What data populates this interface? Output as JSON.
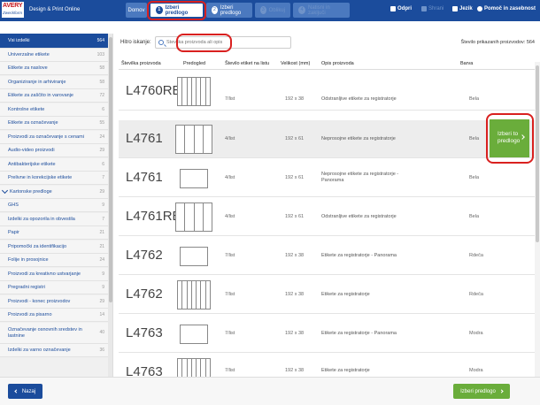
{
  "header": {
    "logo_top": "AVERY",
    "logo_bottom": "Zweckform",
    "app_title": "Design & Print Online",
    "steps": [
      {
        "num": "",
        "label": "Domov"
      },
      {
        "num": "1",
        "label": "Izberi predlogo"
      },
      {
        "num": "2",
        "label": "Izberi predlogo"
      },
      {
        "num": "3",
        "label": "Oblikuj"
      },
      {
        "num": "4",
        "label": "Natisni in zaključi"
      }
    ],
    "actions": {
      "open": "Odpri",
      "save": "Shrani",
      "language": "Jezik",
      "help": "Pomoč in zasebnost"
    }
  },
  "sidebar": {
    "items": [
      {
        "label": "Vsi izdelki",
        "count": "564"
      },
      {
        "label": "Univerzalne etikete",
        "count": "103"
      },
      {
        "label": "Etikete za naslove",
        "count": "58"
      },
      {
        "label": "Organiziranje in arhiviranje",
        "count": "58"
      },
      {
        "label": "Etikete za zaščito in varovanje",
        "count": "72"
      },
      {
        "label": "Kontrolne etikete",
        "count": "6"
      },
      {
        "label": "Etikete za označevanje",
        "count": "55"
      },
      {
        "label": "Proizvodi za označevanje s cenami",
        "count": "24"
      },
      {
        "label": "Audio-video proizvodi",
        "count": "29"
      },
      {
        "label": "Antibakterijske etikete",
        "count": "6"
      },
      {
        "label": "Prelivne in korekcijske etikete",
        "count": "7"
      },
      {
        "label": "Kartonske predloge",
        "count": "29"
      },
      {
        "label": "GHS",
        "count": "9"
      },
      {
        "label": "Izdelki za opozorila in obvestila",
        "count": "7"
      },
      {
        "label": "Papir",
        "count": "21"
      },
      {
        "label": "Pripomočki za identifikacijo",
        "count": "21"
      },
      {
        "label": "Folije in prosojnice",
        "count": "24"
      },
      {
        "label": "Proizvodi za kreativno ustvarjanje",
        "count": "9"
      },
      {
        "label": "Pregradni registri",
        "count": "9"
      },
      {
        "label": "Proizvodi - konec proizvodov",
        "count": "29"
      },
      {
        "label": "Proizvodi za pisarno",
        "count": "14"
      },
      {
        "label": "Označevanje osnovnih sredstev in lastnine",
        "count": "40"
      },
      {
        "label": "Izdelki za varno označevanje",
        "count": "36"
      }
    ]
  },
  "search": {
    "label": "Hitro iskanje:",
    "placeholder": "Številka proizvoda ali opis"
  },
  "shown_count": "Število prikazanih proizvodov: 564",
  "table": {
    "headers": {
      "code": "Številka proizvoda",
      "preview": "Predogled",
      "per_sheet": "Število etiket na listu",
      "size": "Velikost (mm)",
      "desc": "Opis proizvoda",
      "color": "Barva"
    },
    "rows": [
      {
        "code": "L4760REV",
        "per_sheet": "7/list",
        "size": "192 x 38",
        "desc": "Odstranljive etikete za registratorje",
        "color": "Bela"
      },
      {
        "code": "L4761",
        "per_sheet": "4/list",
        "size": "192 x 61",
        "desc": "Neprosojne etikete za registratorje",
        "color": "Bela"
      },
      {
        "code": "L4761",
        "per_sheet": "4/list",
        "size": "192 x 61",
        "desc": "Neprosojne etikete za registratorje - Panorama",
        "color": "Bela"
      },
      {
        "code": "L4761REV",
        "per_sheet": "4/list",
        "size": "192 x 61",
        "desc": "Odstranljive etikete za registratorje",
        "color": "Bela"
      },
      {
        "code": "L4762",
        "per_sheet": "7/list",
        "size": "192 x 38",
        "desc": "Etikete za registratorje - Panorama",
        "color": "Rdeča"
      },
      {
        "code": "L4762",
        "per_sheet": "7/list",
        "size": "192 x 38",
        "desc": "Etikete za registratorje",
        "color": "Rdeča"
      },
      {
        "code": "L4763",
        "per_sheet": "7/list",
        "size": "192 x 38",
        "desc": "Etikete za registratorje - Panorama",
        "color": "Modra"
      },
      {
        "code": "L4763",
        "per_sheet": "7/list",
        "size": "192 x 38",
        "desc": "Etikete za registratorje",
        "color": "Modra"
      }
    ]
  },
  "row_select_button": "Izberi to predlogo",
  "footer": {
    "back": "Nazaj",
    "next": "Izberi predlogo"
  },
  "colors": {
    "brand_blue": "#1b4c9c",
    "accent_green": "#6aad3b",
    "highlight_red": "#d9201f"
  }
}
